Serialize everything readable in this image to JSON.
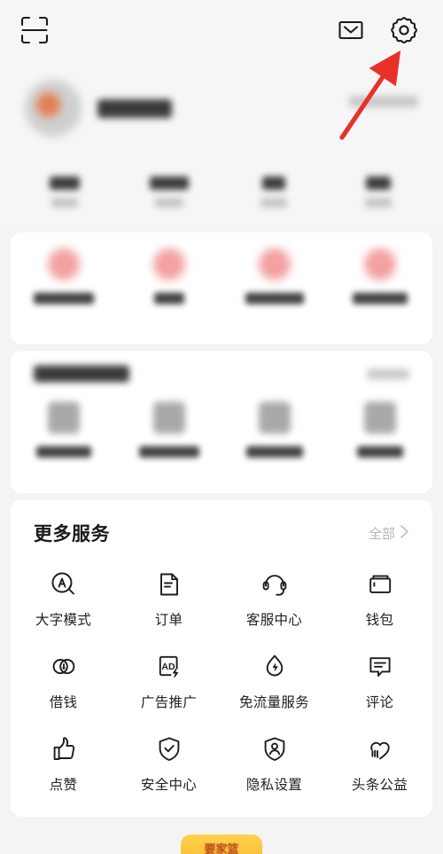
{
  "topbar": {
    "scan_icon": "scan-icon",
    "mail_icon": "mail-envelope-icon",
    "settings_icon": "gear-settings-icon"
  },
  "profile": {
    "avatar": "user-avatar",
    "username_redacted": "",
    "header_link_redacted": ""
  },
  "stats": {
    "items": [
      {
        "value_redacted": "",
        "label_redacted": ""
      },
      {
        "value_redacted": "",
        "label_redacted": ""
      },
      {
        "value_redacted": "",
        "label_redacted": ""
      },
      {
        "value_redacted": "",
        "label_redacted": ""
      }
    ]
  },
  "card_one": {
    "items": [
      {
        "label_redacted": ""
      },
      {
        "label_redacted": ""
      },
      {
        "label_redacted": ""
      },
      {
        "label_redacted": ""
      }
    ]
  },
  "card_two": {
    "title_redacted": "",
    "more_redacted": "",
    "items": [
      {
        "label_redacted": ""
      },
      {
        "label_redacted": ""
      },
      {
        "label_redacted": ""
      },
      {
        "label_redacted": ""
      }
    ]
  },
  "services": {
    "title": "更多服务",
    "more_label": "全部",
    "more_chevron": "chevron-right-icon",
    "items": [
      {
        "label": "大字模式",
        "icon": "large-text-mode-icon"
      },
      {
        "label": "订单",
        "icon": "order-document-icon"
      },
      {
        "label": "客服中心",
        "icon": "headset-support-icon"
      },
      {
        "label": "钱包",
        "icon": "wallet-icon"
      },
      {
        "label": "借钱",
        "icon": "loan-coins-icon"
      },
      {
        "label": "广告推广",
        "icon": "ad-promotion-icon"
      },
      {
        "label": "免流量服务",
        "icon": "free-data-droplet-icon"
      },
      {
        "label": "评论",
        "icon": "comment-bubble-icon"
      },
      {
        "label": "点赞",
        "icon": "thumbs-up-icon"
      },
      {
        "label": "安全中心",
        "icon": "shield-check-icon"
      },
      {
        "label": "隐私设置",
        "icon": "shield-person-icon"
      },
      {
        "label": "头条公益",
        "icon": "charity-heart-hand-icon"
      }
    ]
  },
  "bottom_badge": {
    "text": "要家篮"
  },
  "annotation": {
    "arrow_color": "#e8302a",
    "points_to": "gear-settings-icon"
  },
  "colors": {
    "page_bg": "#f4f4f4",
    "card_bg": "#ffffff",
    "text_primary": "#1a1a1a",
    "text_muted": "#b5b5b5",
    "accent_pink": "#f3a1a1",
    "badge_yellow": "#f9c23c",
    "annotation_red": "#e8302a"
  }
}
